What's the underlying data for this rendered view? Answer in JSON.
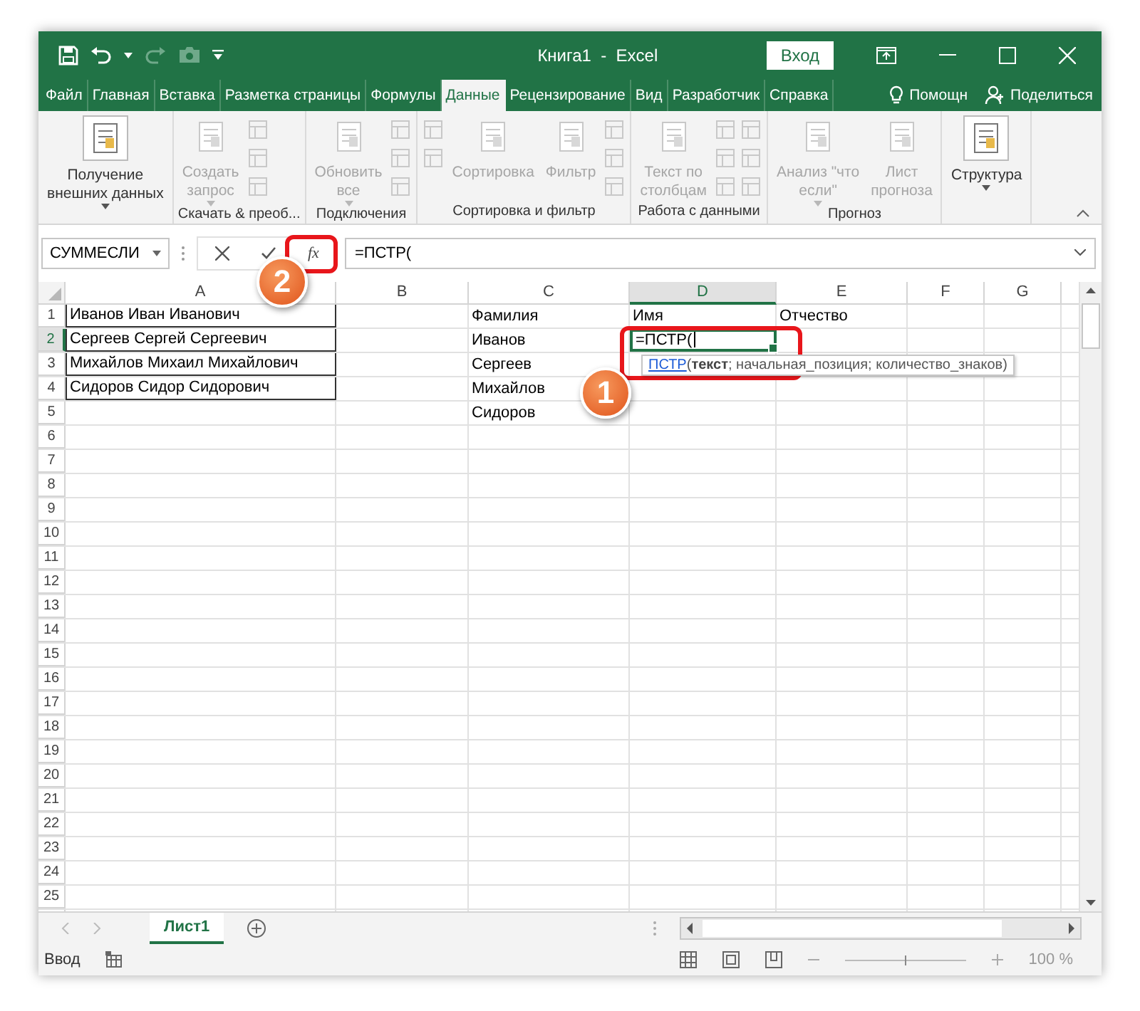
{
  "window": {
    "title": "Книга1  -  Excel",
    "login_button": "Вход"
  },
  "ribbon_tabs": [
    {
      "label": "Файл",
      "selected": false
    },
    {
      "label": "Главная",
      "selected": false
    },
    {
      "label": "Вставка",
      "selected": false
    },
    {
      "label": "Разметка страницы",
      "selected": false
    },
    {
      "label": "Формулы",
      "selected": false
    },
    {
      "label": "Данные",
      "selected": true
    },
    {
      "label": "Рецензирование",
      "selected": false
    },
    {
      "label": "Вид",
      "selected": false
    },
    {
      "label": "Разработчик",
      "selected": false
    },
    {
      "label": "Справка",
      "selected": false
    }
  ],
  "help_search": "Помощн",
  "share": "Поделиться",
  "ribbon_groups": [
    {
      "items": [
        {
          "kind": "large",
          "lines": [
            "Получение",
            "внешних данных"
          ],
          "dropdown": true,
          "disabled": false
        }
      ]
    },
    {
      "label": "Скачать & преоб...",
      "items": [
        {
          "kind": "large",
          "lines": [
            "Создать",
            "запрос"
          ],
          "dropdown": true,
          "disabled": true
        },
        {
          "kind": "icon-stack",
          "disabled": true
        }
      ]
    },
    {
      "label": "Подключения",
      "items": [
        {
          "kind": "large",
          "lines": [
            "Обновить",
            "все"
          ],
          "dropdown": true,
          "disabled": true
        },
        {
          "kind": "icon-stack",
          "disabled": true
        }
      ]
    },
    {
      "label": "Сортировка и фильтр",
      "items": [
        {
          "kind": "sort-stack",
          "disabled": true
        },
        {
          "kind": "large",
          "lines": [
            "Сортировка"
          ],
          "dropdown": false,
          "disabled": true
        },
        {
          "kind": "large",
          "lines": [
            "Фильтр"
          ],
          "dropdown": false,
          "disabled": true
        },
        {
          "kind": "icon-stack",
          "disabled": true
        }
      ]
    },
    {
      "label": "Работа с данными",
      "items": [
        {
          "kind": "large",
          "lines": [
            "Текст по",
            "столбцам"
          ],
          "dropdown": false,
          "disabled": true
        },
        {
          "kind": "icon-stack",
          "disabled": true
        },
        {
          "kind": "icon-stack",
          "disabled": true
        }
      ]
    },
    {
      "label": "Прогноз",
      "items": [
        {
          "kind": "large",
          "lines": [
            "Анализ \"что",
            "если\""
          ],
          "dropdown": true,
          "disabled": true
        },
        {
          "kind": "large",
          "lines": [
            "Лист",
            "прогноза"
          ],
          "dropdown": false,
          "disabled": true
        }
      ]
    },
    {
      "items": [
        {
          "kind": "large",
          "lines": [
            "Структура"
          ],
          "dropdown": true,
          "disabled": false
        }
      ]
    }
  ],
  "formula_bar": {
    "name_box": "СУММЕСЛИ",
    "fx": "fx",
    "formula": "=ПСТР("
  },
  "columns": [
    {
      "label": "A",
      "selected": false
    },
    {
      "label": "B",
      "selected": false
    },
    {
      "label": "C",
      "selected": false
    },
    {
      "label": "D",
      "selected": true
    },
    {
      "label": "E",
      "selected": false
    },
    {
      "label": "F",
      "selected": false
    },
    {
      "label": "G",
      "selected": false
    }
  ],
  "rows": [
    {
      "header": "1",
      "selected": false,
      "cells": [
        {
          "text": "Иванов Иван Иванович",
          "bordered": true,
          "active": false
        },
        null,
        {
          "text": "Фамилия",
          "bordered": false,
          "active": false
        },
        {
          "text": "Имя",
          "bordered": false,
          "active": false
        },
        {
          "text": "Отчество",
          "bordered": false,
          "active": false
        }
      ]
    },
    {
      "header": "2",
      "selected": true,
      "cells": [
        {
          "text": "Сергеев Сергей Сергеевич",
          "bordered": true,
          "active": false
        },
        null,
        {
          "text": "Иванов",
          "bordered": false,
          "active": false
        },
        {
          "text": "=ПСТР(",
          "bordered": false,
          "active": true
        }
      ]
    },
    {
      "header": "3",
      "selected": false,
      "cells": [
        {
          "text": "Михайлов Михаил Михайлович",
          "bordered": true,
          "active": false
        },
        null,
        {
          "text": "Сергеев",
          "bordered": false,
          "active": false
        }
      ]
    },
    {
      "header": "4",
      "selected": false,
      "cells": [
        {
          "text": "Сидоров Сидор Сидорович",
          "bordered": true,
          "active": false
        },
        null,
        {
          "text": "Михайлов",
          "bordered": false,
          "active": false
        }
      ]
    },
    {
      "header": "5",
      "selected": false,
      "cells": [
        null,
        null,
        {
          "text": "Сидоров",
          "bordered": false,
          "active": false
        }
      ]
    },
    {
      "header": "6",
      "selected": false,
      "cells": []
    },
    {
      "header": "7",
      "selected": false,
      "cells": []
    },
    {
      "header": "8",
      "selected": false,
      "cells": []
    },
    {
      "header": "9",
      "selected": false,
      "cells": []
    },
    {
      "header": "10",
      "selected": false,
      "cells": []
    },
    {
      "header": "11",
      "selected": false,
      "cells": []
    },
    {
      "header": "12",
      "selected": false,
      "cells": []
    },
    {
      "header": "13",
      "selected": false,
      "cells": []
    },
    {
      "header": "14",
      "selected": false,
      "cells": []
    },
    {
      "header": "15",
      "selected": false,
      "cells": []
    },
    {
      "header": "16",
      "selected": false,
      "cells": []
    },
    {
      "header": "17",
      "selected": false,
      "cells": []
    },
    {
      "header": "18",
      "selected": false,
      "cells": []
    },
    {
      "header": "19",
      "selected": false,
      "cells": []
    },
    {
      "header": "20",
      "selected": false,
      "cells": []
    },
    {
      "header": "21",
      "selected": false,
      "cells": []
    },
    {
      "header": "22",
      "selected": false,
      "cells": []
    },
    {
      "header": "23",
      "selected": false,
      "cells": []
    },
    {
      "header": "24",
      "selected": false,
      "cells": []
    },
    {
      "header": "25",
      "selected": false,
      "cells": []
    }
  ],
  "tooltip": {
    "function": "ПСТР",
    "arguments": "(**текст**; начальная_позиция; количество_знаков)"
  },
  "annotations": [
    {
      "label": "1"
    },
    {
      "label": "2"
    }
  ],
  "sheet_tabs": [
    {
      "label": "Лист1",
      "selected": true
    }
  ],
  "status_bar": {
    "mode": "Ввод",
    "zoom": "100 %",
    "zoom_slider": {
      "level": 0.5
    }
  }
}
